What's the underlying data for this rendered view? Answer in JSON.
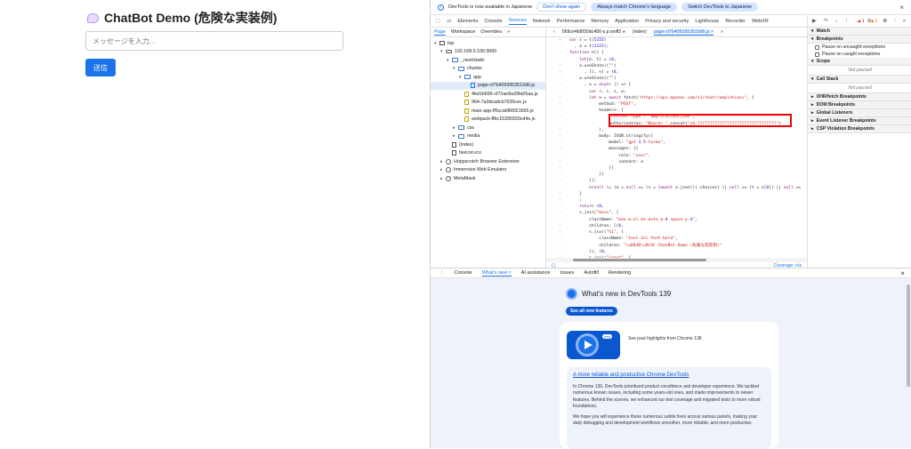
{
  "app": {
    "title": "ChatBot Demo (危険な実装例)",
    "input_placeholder": "メッセージを入力...",
    "send_label": "送信"
  },
  "devtools": {
    "notice": {
      "text": "DevTools is now available in Japanese",
      "btn_dont_show": "Don't show again",
      "btn_always_match": "Always match Chrome's language",
      "btn_switch": "Switch DevTools to Japanese"
    },
    "main_tabs": [
      "Elements",
      "Console",
      "Sources",
      "Network",
      "Performance",
      "Memory",
      "Application",
      "Privacy and security",
      "Lighthouse",
      "Recorder",
      "WebXR"
    ],
    "active_main_tab": "Sources",
    "error_count": "1",
    "warning_count": "1",
    "nav_tabs": [
      "Page",
      "Workspace",
      "Overrides"
    ],
    "tree": [
      {
        "label": "top",
        "indent": 0,
        "kind": "top"
      },
      {
        "label": "192.168.0.100:3000",
        "indent": 1,
        "kind": "cloud"
      },
      {
        "label": "_next/static",
        "indent": 2,
        "kind": "folder"
      },
      {
        "label": "chunks",
        "indent": 3,
        "kind": "folder"
      },
      {
        "label": "app",
        "indent": 4,
        "kind": "folder"
      },
      {
        "label": "page-cf7b4093953510d6.js",
        "indent": 5,
        "kind": "file-sel",
        "selected": true
      },
      {
        "label": "4bd1b696-cf72ae8a39fa05aa.js",
        "indent": 4,
        "kind": "file-js"
      },
      {
        "label": "964-7a3dcadcb7635cec.js",
        "indent": 4,
        "kind": "file-js"
      },
      {
        "label": "main-app-ff5cca6f66f21665.js",
        "indent": 4,
        "kind": "file-js"
      },
      {
        "label": "webpack-ffbc15395550cd4e.js",
        "indent": 4,
        "kind": "file-js"
      },
      {
        "label": "css",
        "indent": 3,
        "kind": "folder"
      },
      {
        "label": "media",
        "indent": 3,
        "kind": "folder"
      },
      {
        "label": "(index)",
        "indent": 2,
        "kind": "file"
      },
      {
        "label": "favicon.ico",
        "indent": 2,
        "kind": "file"
      },
      {
        "label": "Hoppscotch Browser Extension",
        "indent": 1,
        "kind": "gear"
      },
      {
        "label": "Immersive Web Emulator",
        "indent": 1,
        "kind": "gear"
      },
      {
        "label": "MetaMask",
        "indent": 1,
        "kind": "gear"
      }
    ],
    "file_tabs": [
      "569ce4b8f30dc480-s.p.woff2",
      "(index)",
      "page-cf7b4093953510d6.js"
    ],
    "code_lines": [
      "var s = t(5155)",
      "  , a = t(2115);",
      "function n() {",
      "    let[e, t] = (0,",
      "    a.useState)(\"\")",
      "      , [l, n] = (0,",
      "    a.useState)(\"\")",
      "      , o = async () => {",
      "        var r, i, s, a;",
      "        let e = await fetch(\"https://api.openai.com/v1/chat/completions\", {",
      "            method: \"POST\",",
      "            headers: {",
      "                \"Content-Type\": \"application/json\",",
      "                Authorization: \"Bearer \".concat(\"sk-????????????????????????????????\")",
      "            },",
      "            body: JSON.stringify({",
      "                model: \"gpt-3.5-turbo\",",
      "                messages: [{",
      "                    role: \"user\",",
      "                    content: e",
      "                }]",
      "            })",
      "        });",
      "        n(null != (a = null == (s = (await e.json()).choices) || null == (t = s[0]) || null ==",
      "    }",
      "    ;",
      "    return (0,",
      "    s.jsx)(\"main\", {",
      "        className: \"max-w-xl mx-auto p-4 space-y-4\",",
      "        children: [(0,",
      "        s.jsx)(\"h1\", {",
      "            className: \"text-2xl font-bold\",",
      "            children: \"\\uD83D\\uDCAC ChatBot Demo (危険な実装例)\"",
      "        }), (0,",
      "        s.jsx)(\"input\", {"
    ],
    "status_left": "{ }",
    "coverage": "Coverage: n/a",
    "debugger": {
      "sections": [
        {
          "title": "Watch",
          "rows": []
        },
        {
          "title": "Breakpoints",
          "rows": [
            "Pause on uncaught exceptions",
            "Pause on caught exceptions"
          ]
        },
        {
          "title": "Scope",
          "note": "Not paused"
        },
        {
          "title": "Call Stack",
          "note": "Not paused"
        },
        {
          "title": "XHR/fetch Breakpoints"
        },
        {
          "title": "DOM Breakpoints"
        },
        {
          "title": "Global Listeners"
        },
        {
          "title": "Event Listener Breakpoints"
        },
        {
          "title": "CSP Violation Breakpoints"
        }
      ]
    },
    "drawer": {
      "tabs": [
        "Console",
        "What's new",
        "AI assistance",
        "Issues",
        "Autofill",
        "Rendering"
      ],
      "active": "What's new",
      "heading": "What's new in DevTools 139",
      "see_all": "See all new features",
      "video_badge": "new",
      "video_caption": "See past highlights from Chrome 138",
      "feature_title": "A more reliable and productive Chrome DevTools",
      "feature_p1": "In Chrome 139, DevTools prioritized product excellence and developer experience. We tackled numerous known issues, including some years-old ones, and made improvements to newer features. Behind the scenes, we enhanced our test coverage and migrated tests to more robust foundations.",
      "feature_p2": "We hope you will experience these numerous subtle fixes across various panels, making your daily debugging and development workflows smoother, more reliable, and more productive."
    }
  }
}
